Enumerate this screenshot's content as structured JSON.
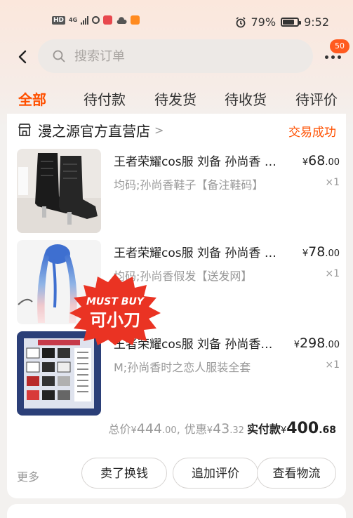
{
  "status_bar": {
    "hd": "HD",
    "network": "4G",
    "battery": "79%",
    "battery_level": 0.79,
    "time": "9:52"
  },
  "search": {
    "placeholder": "搜索订单",
    "value": ""
  },
  "badge": "50",
  "tabs": [
    {
      "label": "全部",
      "active": true
    },
    {
      "label": "待付款"
    },
    {
      "label": "待发货"
    },
    {
      "label": "待收货"
    },
    {
      "label": "待评价"
    }
  ],
  "order": {
    "store_name": "漫之源官方直营店",
    "status": "交易成功",
    "items": [
      {
        "title": "王者荣耀cos服 刘备 孙尚香 情人节 时之恋人cosplay服装",
        "price_currency": "¥",
        "price_int": "68",
        "price_dec": ".00",
        "spec": "均码;孙尚香鞋子【备注鞋码】",
        "qty": "×1"
      },
      {
        "title": "王者荣耀cos服 刘备 孙尚香 情人节 时之恋人cosplay服装",
        "price_currency": "¥",
        "price_int": "78",
        "price_dec": ".00",
        "spec": "均码;孙尚香假发【送发网】",
        "qty": "×1"
      },
      {
        "title": "王者荣耀cos服 刘备 孙尚香 情人节 时之恋人cosplay服装",
        "price_currency": "¥",
        "price_int": "298",
        "price_dec": ".00",
        "spec": "M;孙尚香时之恋人服装全套",
        "qty": "×1"
      }
    ],
    "sticker": {
      "line1": "MUST BUY",
      "line2": "可小刀"
    },
    "totals": {
      "total_label": "总价",
      "total_currency": "¥",
      "total_int": "444",
      "total_dec": ".00",
      "separator": ",",
      "discount_label": "优惠",
      "discount_currency": "¥",
      "discount_int": "43",
      "discount_dec": ".32",
      "paid_label": "实付款",
      "paid_currency": "¥",
      "paid_int": "400",
      "paid_dec": ".68"
    },
    "more_label": "更多",
    "buttons": [
      "卖了换钱",
      "追加评价",
      "查看物流"
    ]
  },
  "colors": {
    "accent": "#ff5000",
    "badge": "#ff5a1f",
    "sticker_red": "#ea3323",
    "page_bg": "#f3f1ef"
  },
  "icons": [
    "back-arrow-icon",
    "search-icon",
    "more-dots-icon",
    "store-icon",
    "chevron-right-icon"
  ]
}
